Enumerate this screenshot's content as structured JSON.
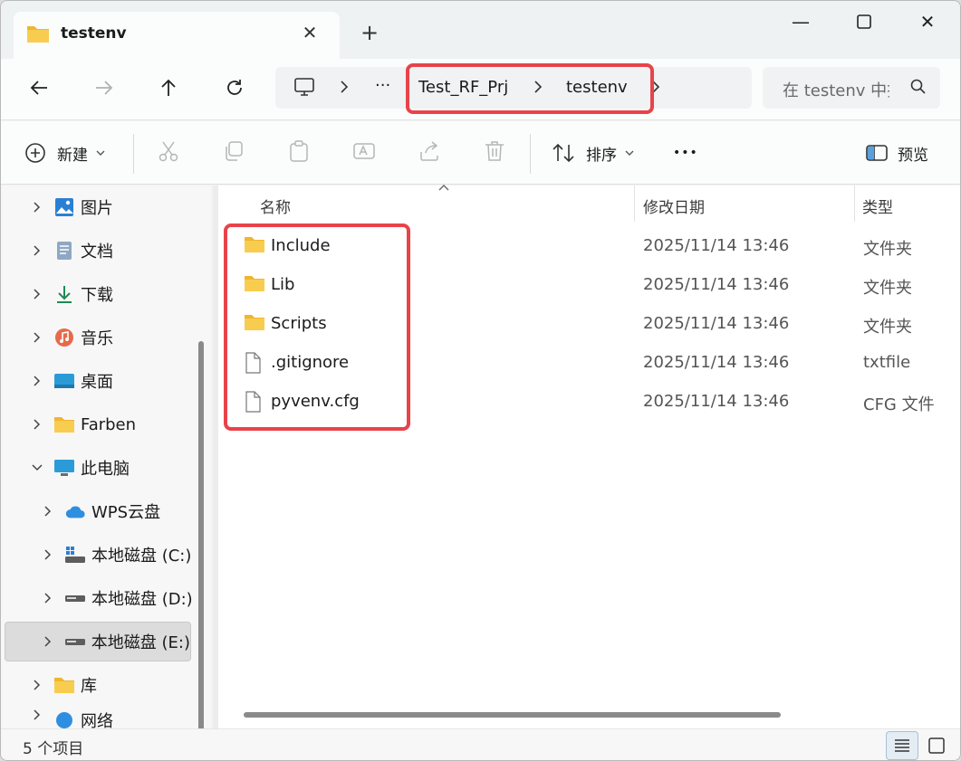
{
  "window": {
    "tab_title": "testenv",
    "close_tab": "✕",
    "new_tab": "+",
    "minimize": "—",
    "maximize": "☐",
    "close": "✕"
  },
  "address_bar": {
    "overflow": "···",
    "breadcrumbs": [
      "Test_RF_Prj",
      "testenv"
    ],
    "search_placeholder": "在 testenv 中搜索"
  },
  "command_bar": {
    "new_label": "新建",
    "sort_label": "排序",
    "more_label": "•••",
    "preview_label": "预览"
  },
  "sidebar": {
    "items": [
      {
        "label": "图片",
        "icon": "pictures-icon"
      },
      {
        "label": "文档",
        "icon": "documents-icon"
      },
      {
        "label": "下载",
        "icon": "downloads-icon"
      },
      {
        "label": "音乐",
        "icon": "music-icon"
      },
      {
        "label": "桌面",
        "icon": "desktop-icon"
      },
      {
        "label": "Farben",
        "icon": "folder-icon"
      },
      {
        "label": "此电脑",
        "icon": "this-pc-icon"
      },
      {
        "label": "WPS云盘",
        "icon": "cloud-icon"
      },
      {
        "label": "本地磁盘 (C:)",
        "icon": "drive-c-icon"
      },
      {
        "label": "本地磁盘 (D:)",
        "icon": "drive-icon"
      },
      {
        "label": "本地磁盘 (E:)",
        "icon": "drive-icon"
      },
      {
        "label": "库",
        "icon": "library-icon"
      },
      {
        "label": "网络",
        "icon": "network-icon"
      }
    ]
  },
  "file_list": {
    "columns": {
      "name": "名称",
      "modified": "修改日期",
      "type": "类型"
    },
    "rows": [
      {
        "name": "Include",
        "modified": "2025/11/14 13:46",
        "type": "文件夹",
        "icon": "folder-icon"
      },
      {
        "name": "Lib",
        "modified": "2025/11/14 13:46",
        "type": "文件夹",
        "icon": "folder-icon"
      },
      {
        "name": "Scripts",
        "modified": "2025/11/14 13:46",
        "type": "文件夹",
        "icon": "folder-icon"
      },
      {
        "name": ".gitignore",
        "modified": "2025/11/14 13:46",
        "type": "txtfile",
        "icon": "file-icon"
      },
      {
        "name": "pyvenv.cfg",
        "modified": "2025/11/14 13:46",
        "type": "CFG 文件",
        "icon": "file-icon"
      }
    ]
  },
  "status_bar": {
    "item_count": "5 个项目"
  },
  "colors": {
    "highlight_box": "#e8434a",
    "folder": "#f6c544"
  }
}
